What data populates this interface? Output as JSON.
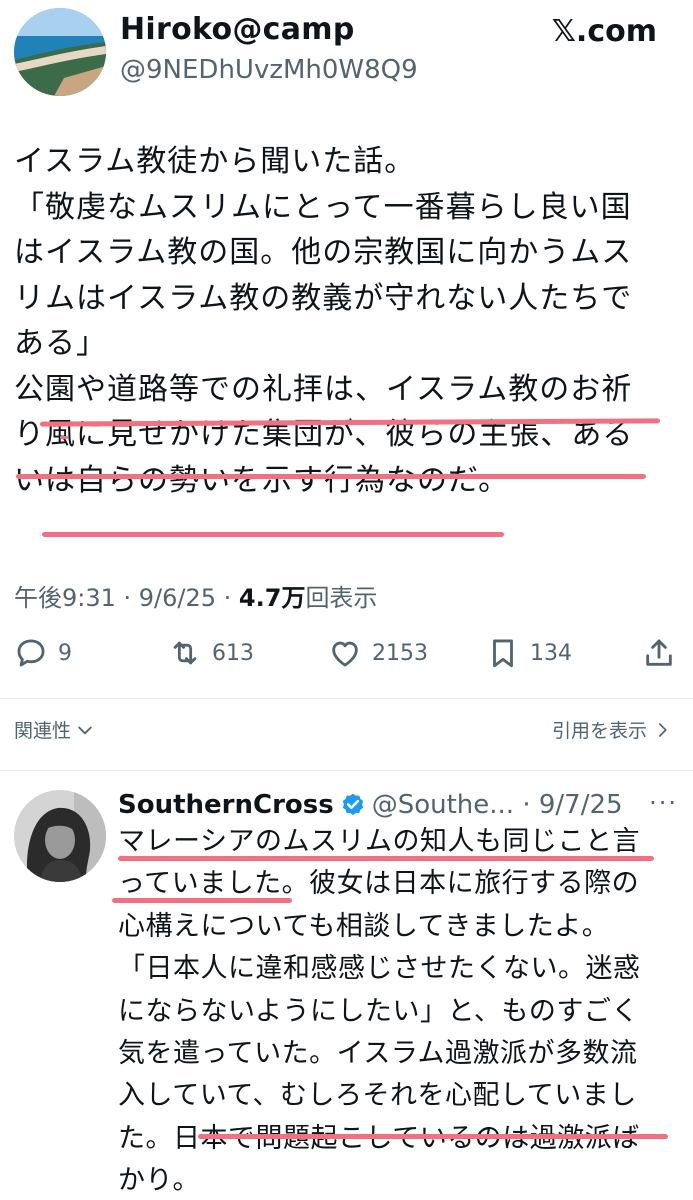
{
  "tweet": {
    "author_name": "Hiroko@camp",
    "author_handle": "@9NEDhUvzMh0W8Q9",
    "brand": "𝕏.com",
    "body_lines": [
      "イスラム教徒から聞いた話。",
      "「敬虔なムスリムにとって一番暮らし良い国",
      "はイスラム教の国。他の宗教国に向かうムス",
      "リムはイスラム教の教義が守れない人たちで",
      "ある」",
      "公園や道路等での礼拝は、イスラム教のお祈",
      "り風に見せかけた集団が、彼らの主張、ある",
      "いは自らの勢いを示す行為なのだ。"
    ],
    "time": "午後9:31 · 9/6/25 · ",
    "views_count": "4.7万",
    "views_label": "回表示",
    "replies": "9",
    "reposts": "613",
    "likes": "2153",
    "bookmarks": "134"
  },
  "links": {
    "related": "関連性",
    "quotes": "引用を表示"
  },
  "reply": {
    "author_name": "SouthernCross",
    "author_handle": "@Southe... · 9/7/25",
    "more": "···",
    "body_lines": [
      "マレーシアのムスリムの知人も同じこと言",
      "っていました。彼女は日本に旅行する際の",
      "心構えについても相談してきましたよ。",
      "「日本人に違和感感じさせたくない。迷惑",
      "にならないようにしたい」と、ものすごく",
      "気を遣っていた。イスラム過激派が多数流",
      "入していて、むしろそれを心配していまし",
      "た。日本で問題起こしているのは過激派ば",
      "かり。"
    ]
  },
  "colors": {
    "underline": "#f2707f",
    "verified": "#1d9bf0",
    "secondary_text": "#536471"
  },
  "icons": [
    "reply-icon",
    "repost-icon",
    "like-icon",
    "bookmark-icon",
    "share-icon",
    "chevron-down-icon",
    "chevron-right-icon",
    "verified-icon",
    "more-icon"
  ]
}
